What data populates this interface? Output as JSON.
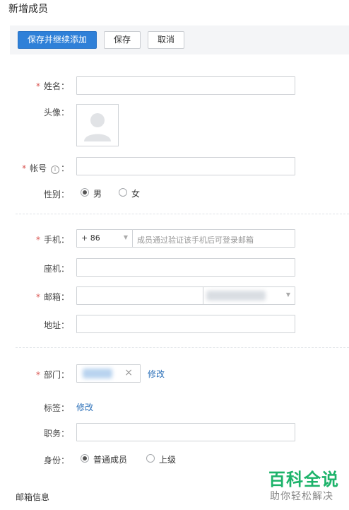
{
  "page": {
    "title": "新增成员"
  },
  "toolbar": {
    "save_continue_label": "保存并继续添加",
    "save_label": "保存",
    "cancel_label": "取消"
  },
  "fields": {
    "name_label": "姓名：",
    "avatar_label": "头像：",
    "account_label": "帐号",
    "account_suffix": "：",
    "gender_label": "性别：",
    "gender_options": [
      "男",
      "女"
    ],
    "gender_selected": "男",
    "phone_label": "手机：",
    "phone_code": "+ 86",
    "phone_placeholder": "成员通过验证该手机后可登录邮箱",
    "landline_label": "座机：",
    "email_label": "邮箱：",
    "address_label": "地址：",
    "department_label": "部门：",
    "department_edit": "修改",
    "tags_label": "标签：",
    "tags_edit": "修改",
    "position_label": "职务：",
    "identity_label": "身份：",
    "identity_options": [
      "普通成员",
      "上级"
    ],
    "identity_selected": "普通成员",
    "required_mark": "*",
    "info_icon_glyph": "i"
  },
  "footer": {
    "section_label": "邮箱信息"
  },
  "watermark": {
    "title": "百科全说",
    "subtitle": "助你轻松解决"
  },
  "colors": {
    "primary": "#2f80d8",
    "required": "#d9534f",
    "link": "#2a6fb8",
    "watermark": "#1db36a"
  },
  "icons": {
    "avatar": "person-silhouette-icon",
    "info": "info-circle-icon",
    "dropdown": "caret-down-icon",
    "remove": "close-icon"
  }
}
